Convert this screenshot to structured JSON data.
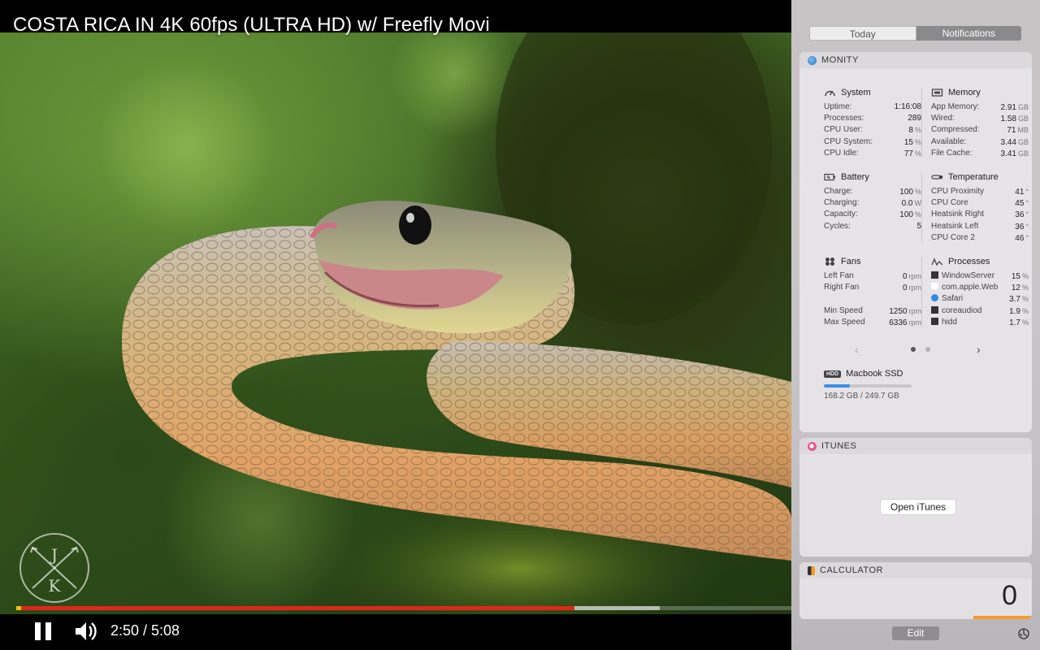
{
  "video": {
    "title": "COSTA RICA IN 4K 60fps (ULTRA HD) w/ Freefly Movi",
    "channel_logo_letters": [
      "J",
      "K"
    ],
    "time": "2:50 / 5:08",
    "played_fraction": 0.72,
    "buffered_fraction": 0.83,
    "icons": {
      "pause": "pause-icon",
      "volume": "volume-icon"
    },
    "colors": {
      "progress_played": "#e0261b",
      "progress_start": "#f4c20d"
    }
  },
  "notification_center": {
    "tabs": [
      {
        "label": "Today",
        "selected": true
      },
      {
        "label": "Notifications",
        "selected": false
      }
    ],
    "monity": {
      "title": "MONITY",
      "system": {
        "title": "System",
        "rows": [
          {
            "label": "Uptime:",
            "value": "1:16:08",
            "unit": ""
          },
          {
            "label": "Processes:",
            "value": "289",
            "unit": ""
          },
          {
            "label": "CPU User:",
            "value": "8",
            "unit": "%"
          },
          {
            "label": "CPU System:",
            "value": "15",
            "unit": "%"
          },
          {
            "label": "CPU Idle:",
            "value": "77",
            "unit": "%"
          }
        ]
      },
      "memory": {
        "title": "Memory",
        "rows": [
          {
            "label": "App Memory:",
            "value": "2.91",
            "unit": "GB"
          },
          {
            "label": "Wired:",
            "value": "1.58",
            "unit": "GB"
          },
          {
            "label": "Compressed:",
            "value": "71",
            "unit": "MB"
          },
          {
            "label": "Available:",
            "value": "3.44",
            "unit": "GB"
          },
          {
            "label": "File Cache:",
            "value": "3.41",
            "unit": "GB"
          }
        ]
      },
      "battery": {
        "title": "Battery",
        "rows": [
          {
            "label": "Charge:",
            "value": "100",
            "unit": "%"
          },
          {
            "label": "Charging:",
            "value": "0.0",
            "unit": "W"
          },
          {
            "label": "Capacity:",
            "value": "100",
            "unit": "%"
          },
          {
            "label": "Cycles:",
            "value": "5",
            "unit": ""
          }
        ]
      },
      "temperature": {
        "title": "Temperature",
        "rows": [
          {
            "label": "CPU Proximity",
            "value": "41",
            "unit": "°"
          },
          {
            "label": "CPU Core",
            "value": "45",
            "unit": "°"
          },
          {
            "label": "Heatsink Right",
            "value": "36",
            "unit": "°"
          },
          {
            "label": "Heatsink Left",
            "value": "36",
            "unit": "°"
          },
          {
            "label": "CPU Core 2",
            "value": "46",
            "unit": "°"
          }
        ]
      },
      "fans": {
        "title": "Fans",
        "rows": [
          {
            "label": "Left Fan",
            "value": "0",
            "unit": "rpm"
          },
          {
            "label": "Right Fan",
            "value": "0",
            "unit": "rpm"
          },
          {
            "label": "",
            "value": "",
            "unit": ""
          },
          {
            "label": "Min Speed",
            "value": "1250",
            "unit": "rpm"
          },
          {
            "label": "Max Speed",
            "value": "6336",
            "unit": "rpm"
          }
        ]
      },
      "processes": {
        "title": "Processes",
        "rows": [
          {
            "label": "WindowServer",
            "value": "15",
            "unit": "%",
            "icon": "window-icon"
          },
          {
            "label": "com.apple.Web",
            "value": "12",
            "unit": "%",
            "icon": "shield-icon"
          },
          {
            "label": "Safari",
            "value": "3.7",
            "unit": "%",
            "icon": "safari-icon"
          },
          {
            "label": "coreaudiod",
            "value": "1.9",
            "unit": "%",
            "icon": "window-icon"
          },
          {
            "label": "hidd",
            "value": "1.7",
            "unit": "%",
            "icon": "window-icon"
          }
        ]
      },
      "pager": {
        "page_count": 2,
        "current_page": 1,
        "prev": "‹",
        "next": "›"
      },
      "ssd": {
        "badge": "HDD",
        "name": "Macbook SSD",
        "used_label": "168.2 GB / 249.7 GB",
        "used_fraction": 0.3
      }
    },
    "itunes": {
      "title": "ITUNES",
      "button": "Open iTunes"
    },
    "calculator": {
      "title": "CALCULATOR",
      "display": "0"
    },
    "edit_button": "Edit",
    "colors": {
      "ssd_fill": "#3a8fe6",
      "calc_accent": "#f39c2a"
    }
  }
}
